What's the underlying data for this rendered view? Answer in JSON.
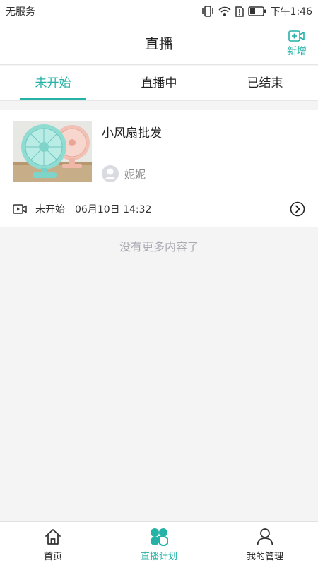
{
  "status_bar": {
    "carrier": "无服务",
    "time": "下午1:46"
  },
  "header": {
    "title": "直播",
    "add_label": "新增"
  },
  "tabs": [
    {
      "label": "未开始",
      "active": true
    },
    {
      "label": "直播中",
      "active": false
    },
    {
      "label": "已结束",
      "active": false
    }
  ],
  "stream": {
    "title": "小风扇批发",
    "host": "妮妮",
    "status": "未开始",
    "time": "06月10日 14:32"
  },
  "no_more_text": "没有更多内容了",
  "bottom_nav": [
    {
      "label": "首页",
      "icon": "home-icon",
      "active": false
    },
    {
      "label": "直播计划",
      "icon": "live-plan-icon",
      "active": true
    },
    {
      "label": "我的管理",
      "icon": "user-icon",
      "active": false
    }
  ],
  "colors": {
    "accent": "#24b2a6",
    "muted": "#a9a9b2"
  }
}
